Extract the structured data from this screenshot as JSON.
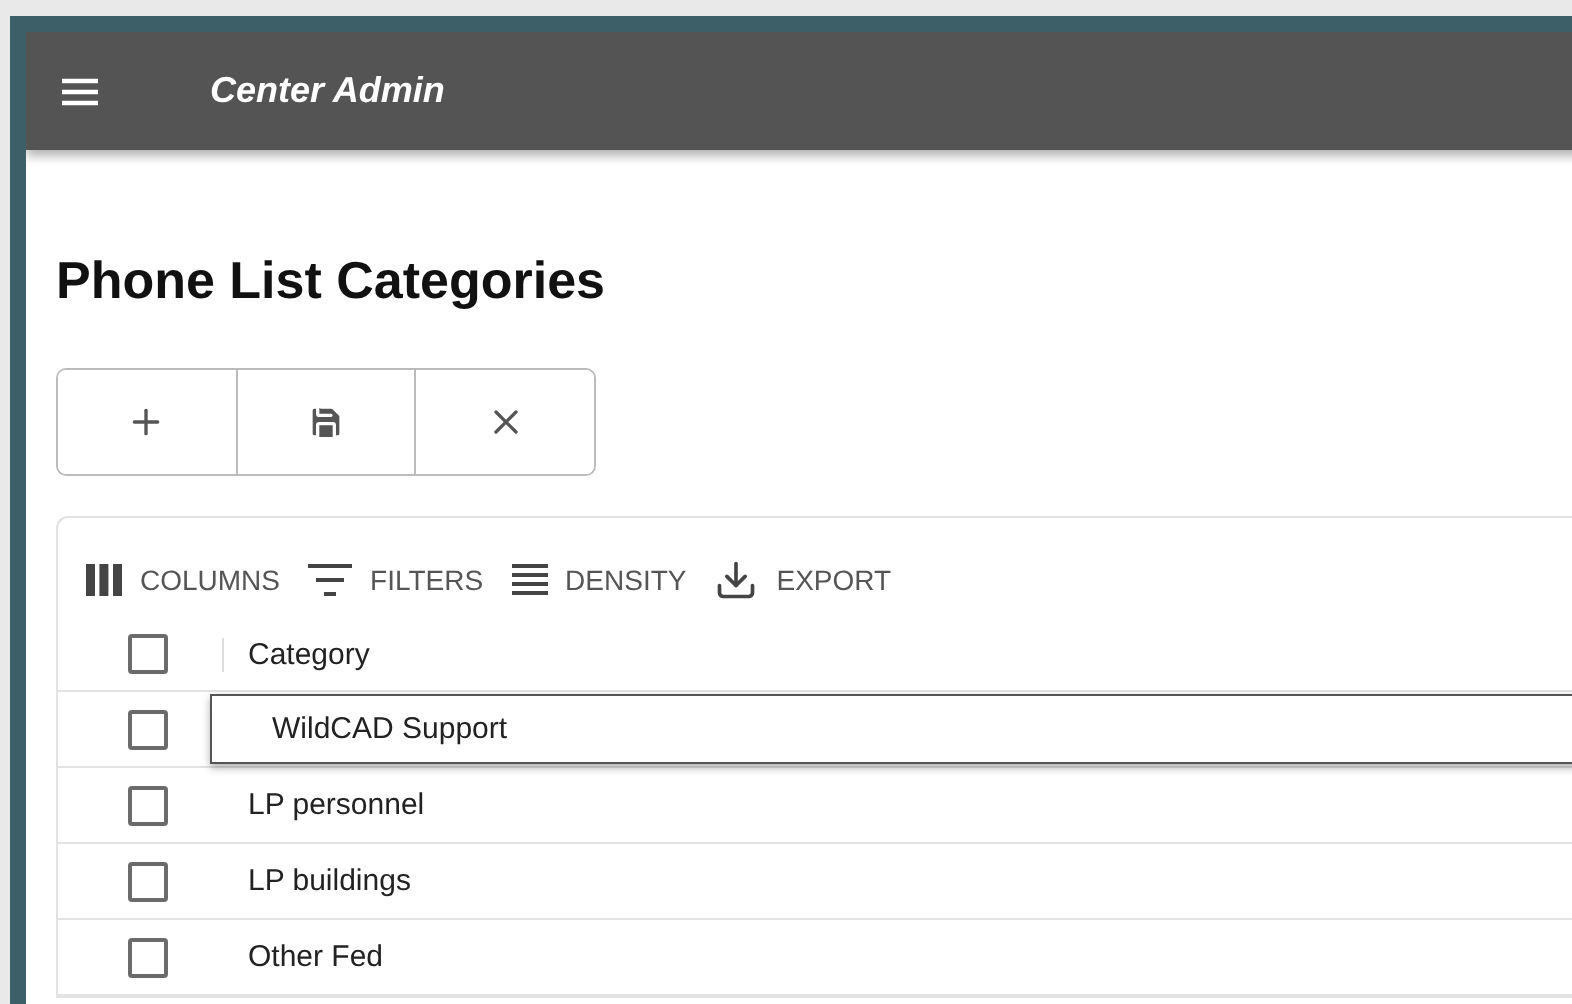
{
  "app_bar": {
    "title": "Center Admin"
  },
  "page": {
    "title": "Phone List Categories"
  },
  "actions": [
    {
      "kind": "add"
    },
    {
      "kind": "save"
    },
    {
      "kind": "cancel"
    }
  ],
  "grid_toolbar": [
    {
      "kind": "columns",
      "label": "COLUMNS"
    },
    {
      "kind": "filters",
      "label": "FILTERS"
    },
    {
      "kind": "density",
      "label": "DENSITY"
    },
    {
      "kind": "export",
      "label": "EXPORT"
    }
  ],
  "table": {
    "header_checked": false,
    "columns": [
      "Category"
    ],
    "rows": [
      {
        "category": "WildCAD Support",
        "editing": true,
        "checked": false
      },
      {
        "category": "LP personnel",
        "editing": false,
        "checked": false
      },
      {
        "category": "LP buildings",
        "editing": false,
        "checked": false
      },
      {
        "category": "Other Fed",
        "editing": false,
        "checked": false
      }
    ]
  }
}
